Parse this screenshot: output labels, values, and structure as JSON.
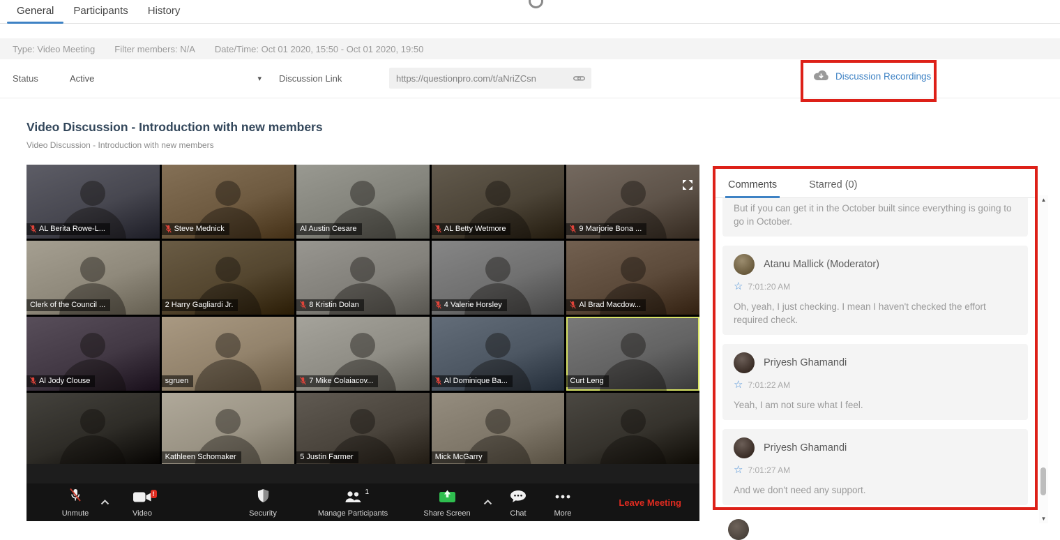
{
  "tabs": {
    "items": [
      {
        "label": "General",
        "active": true
      },
      {
        "label": "Participants",
        "active": false
      },
      {
        "label": "History",
        "active": false
      }
    ]
  },
  "meta": {
    "type": "Type: Video Meeting",
    "filter": "Filter members: N/A",
    "datetime": "Date/Time: Oct 01 2020, 15:50 - Oct 01 2020, 19:50"
  },
  "status_row": {
    "status_label": "Status",
    "status_value": "Active",
    "link_label": "Discussion Link",
    "link_url": "https://questionpro.com/t/aNriZCsn",
    "recordings_label": "Discussion Recordings"
  },
  "discussion": {
    "title": "Video Discussion - Introduction with new members",
    "subtitle": "Video Discussion - Introduction with new members"
  },
  "meeting": {
    "participants": [
      {
        "name": "AL Berita Rowe-L...",
        "muted": true,
        "color": "#474750"
      },
      {
        "name": "Steve Mednick",
        "muted": true,
        "color": "#6e5a40"
      },
      {
        "name": "Al Austin Cesare",
        "muted": false,
        "color": "#83837b"
      },
      {
        "name": "AL Betty Wetmore",
        "muted": true,
        "color": "#4c4437"
      },
      {
        "name": "9 Marjorie Bona ...",
        "muted": true,
        "color": "#5e5349"
      },
      {
        "name": "Clerk of the Council ...",
        "muted": false,
        "color": "#8f897b"
      },
      {
        "name": "2 Harry Gagliardi Jr.",
        "muted": false,
        "color": "#54462f"
      },
      {
        "name": "8 Kristin Dolan",
        "muted": true,
        "color": "#82807a"
      },
      {
        "name": "4 Valerie Horsley",
        "muted": true,
        "color": "#707070"
      },
      {
        "name": "Al Brad Macdow...",
        "muted": true,
        "color": "#5c4a3a"
      },
      {
        "name": "Al Jody Clouse",
        "muted": true,
        "color": "#423844"
      },
      {
        "name": "sgruen",
        "muted": false,
        "color": "#93836c"
      },
      {
        "name": "7 Mike Colaiacov...",
        "muted": true,
        "color": "#8f8d85"
      },
      {
        "name": "Al Dominique Ba...",
        "muted": true,
        "color": "#4d5763"
      },
      {
        "name": "Curt Leng",
        "muted": false,
        "active_speaker": true,
        "color": "#636363"
      },
      {
        "name": "",
        "muted": false,
        "color": "#2e2c27"
      },
      {
        "name": "Kathleen Schomaker",
        "muted": false,
        "color": "#9a9384"
      },
      {
        "name": "5 Justin Farmer",
        "muted": false,
        "color": "#4a443c"
      },
      {
        "name": "Mick McGarry",
        "muted": false,
        "color": "#7f7769"
      },
      {
        "name": "",
        "muted": false,
        "color": "#35322c"
      }
    ],
    "toolbar": {
      "unmute": "Unmute",
      "video": "Video",
      "video_badge": "!",
      "security": "Security",
      "manage_participants": "Manage Participants",
      "participants_count": "1",
      "share_screen": "Share Screen",
      "chat": "Chat",
      "more": "More",
      "leave": "Leave Meeting"
    }
  },
  "comments_panel": {
    "tabs": [
      {
        "label": "Comments",
        "active": true
      },
      {
        "label": "Starred (0)",
        "active": false
      }
    ],
    "comments": [
      {
        "partial": true,
        "text": "But if you can get it in the October built since everything is going to go in October."
      },
      {
        "name": "Atanu Mallick (Moderator)",
        "time": "7:01:20 AM",
        "text": "Oh, yeah, I just checking. I mean I haven't checked the effort required check.",
        "avatar_color": "#7d6e50"
      },
      {
        "name": "Priyesh Ghamandi",
        "time": "7:01:22 AM",
        "text": "Yeah, I am not sure what I feel.",
        "avatar_color": "#4d4039"
      },
      {
        "name": "Priyesh Ghamandi",
        "time": "7:01:27 AM",
        "text": "And we don't need any support.",
        "avatar_color": "#4d4039"
      }
    ]
  },
  "colors": {
    "accent_blue": "#3e82c4",
    "annotation_red": "#dd2018",
    "leave_red": "#e02b20",
    "share_green": "#2fbe4f",
    "muted_mic_red": "#e0443a"
  }
}
